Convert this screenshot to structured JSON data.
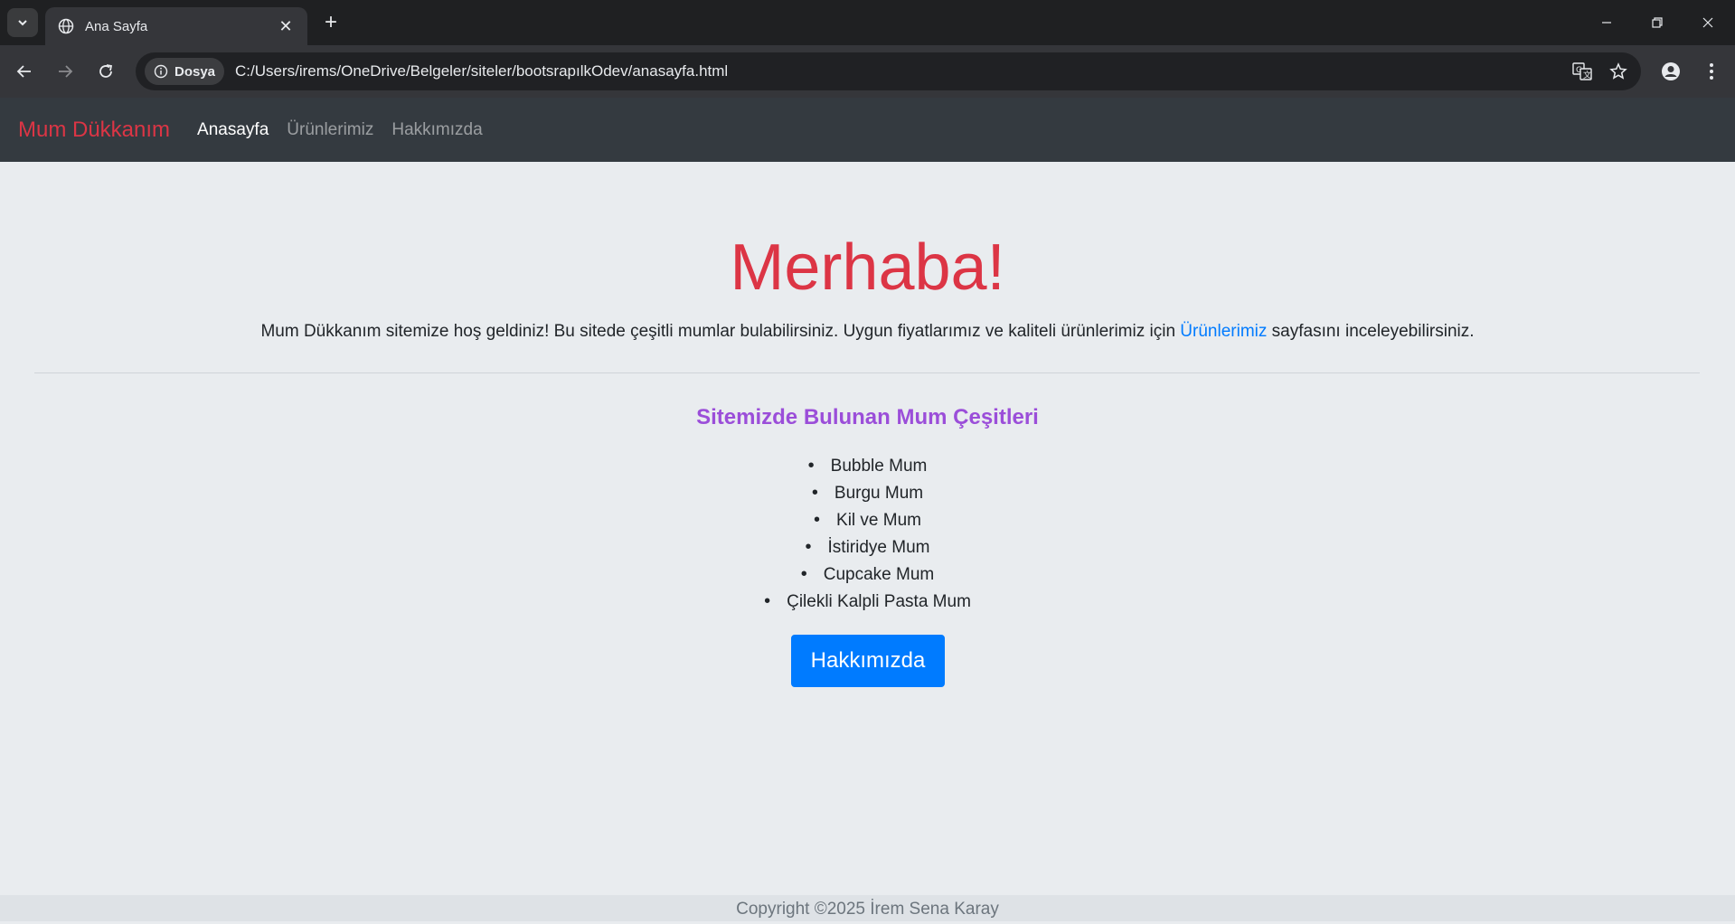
{
  "browser": {
    "tab": {
      "title": "Ana Sayfa",
      "close_glyph": "✕"
    },
    "new_tab_glyph": "+",
    "site_info_label": "Dosya",
    "url": "C:/Users/irems/OneDrive/Belgeler/siteler/bootsrapılkOdev/anasayfa.html",
    "icons": [
      "tab-list-icon",
      "globe-icon",
      "close-icon",
      "plus-icon",
      "minimize-icon",
      "restore-icon",
      "window-close-icon",
      "back-icon",
      "forward-icon",
      "reload-icon",
      "info-icon",
      "translate-icon",
      "star-icon",
      "profile-icon",
      "menu-icon"
    ]
  },
  "navbar": {
    "brand": "Mum Dükkanım",
    "links": [
      {
        "label": "Anasayfa",
        "state": "active"
      },
      {
        "label": "Ürünlerimiz",
        "state": "muted"
      },
      {
        "label": "Hakkımızda",
        "state": "muted"
      }
    ]
  },
  "hero": {
    "title": "Merhaba!",
    "lead_before": "Mum Dükkanım sitemize hoş geldiniz! Bu sitede çeşitli mumlar bulabilirsiniz. Uygun fiyatlarımız ve kaliteli ürünlerimiz için ",
    "lead_link": "Ürünlerimiz",
    "lead_after": " sayfasını inceleyebilirsiniz."
  },
  "section": {
    "title": "Sitemizde Bulunan Mum Çeşitleri",
    "items": [
      "Bubble Mum",
      "Burgu Mum",
      "Kil ve Mum",
      "İstiridye Mum",
      "Cupcake Mum",
      "Çilekli Kalpli Pasta Mum"
    ]
  },
  "button": {
    "label": "Hakkımızda"
  },
  "footer": {
    "text": "Copyright ©2025 İrem Sena Karay"
  },
  "colors": {
    "brand_red": "#dc3545",
    "link_blue": "#007bff",
    "section_purple": "#9b4ed9",
    "navbar_bg": "#343a40",
    "page_bg": "#e9ecef"
  }
}
